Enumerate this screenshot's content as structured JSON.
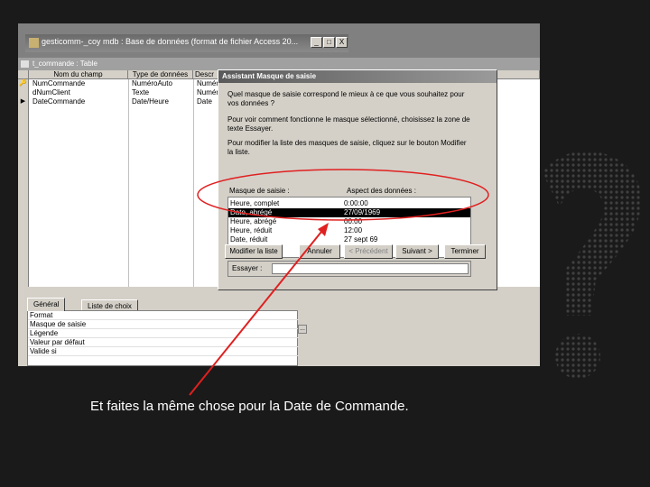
{
  "access_window": {
    "title": "gesticomm-_coy mdb : Base de données (format de fichier Access 20...",
    "minimize": "_",
    "maximize": "□",
    "close": "X"
  },
  "table_window": {
    "title": "t_commande : Table"
  },
  "table_grid": {
    "headers": [
      "Nom du champ",
      "Type de données",
      "Descr"
    ],
    "rows": [
      {
        "selector": "🔑",
        "field": "NumCommande",
        "type": "NuméroAuto",
        "descr": "Numér"
      },
      {
        "selector": "",
        "field": "dNumClient",
        "type": "Texte",
        "descr": "Numér"
      },
      {
        "selector": "▶",
        "field": "DateCommande",
        "type": "Date/Heure",
        "descr": "Date"
      }
    ]
  },
  "properties": {
    "tabs": [
      "Général",
      "Liste de choix"
    ],
    "rows": [
      "Format",
      "Masque de saisie",
      "Légende",
      "Valeur par défaut",
      "Valide si"
    ],
    "builder_button": "..."
  },
  "wizard": {
    "title": "Assistant Masque de saisie",
    "question": "Quel masque de saisie correspond le mieux à ce que vous souhaitez pour vos données ?",
    "hint_test": "Pour voir comment fonctionne le masque sélectionné, choisissez la zone de texte Essayer.",
    "hint_modify": "Pour modifier la liste des masques de saisie, cliquez sur le bouton Modifier la liste.",
    "col_mask": "Masque de saisie :",
    "col_preview": "Aspect des données :",
    "masks": [
      {
        "name": "Heure, complet",
        "preview": "0:00:00"
      },
      {
        "name": "Date, abrégé",
        "preview": "27/09/1969"
      },
      {
        "name": "Heure, abrégé",
        "preview": "00:00"
      },
      {
        "name": "Heure, réduit",
        "preview": "12:00"
      },
      {
        "name": "Date, réduit",
        "preview": "27 sept 69"
      }
    ],
    "try_label": "Essayer :",
    "buttons": {
      "modify": "Modifier la liste",
      "cancel": "Annuler",
      "previous": "< Précédent",
      "next": "Suivant >",
      "finish": "Terminer"
    }
  },
  "caption": "Et faites la même chose pour la Date de Commande.",
  "colors": {
    "annotation": "#e02020",
    "background": "#1a1a1a"
  }
}
